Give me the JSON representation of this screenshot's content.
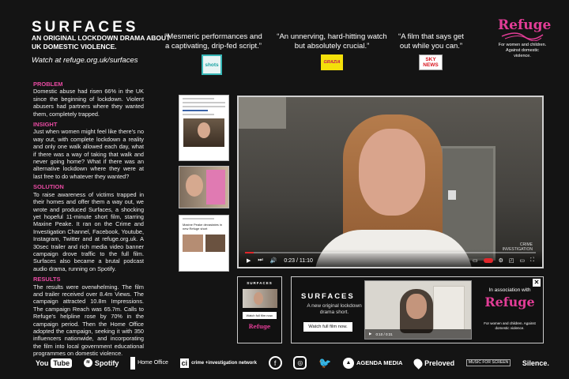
{
  "header": {
    "title": "SURFACES",
    "subtitle": "AN ORIGINAL LOCKDOWN DRAMA ABOUT UK DOMESTIC VIOLENCE.",
    "watch": "Watch at refuge.org.uk/surfaces"
  },
  "quotes": [
    {
      "text": "“Mesmeric performances and a captivating, drip-fed script.”",
      "source": "shots"
    },
    {
      "text": "“An unnerving, hard-hitting watch but absolutely crucial.”",
      "source": "GRAZIA"
    },
    {
      "text": "“A film that says get out while you can.”",
      "source_top": "SKY",
      "source_bottom": "NEWS"
    }
  ],
  "refuge": {
    "name": "Refuge",
    "tagline": "For women and children. Against domestic violence."
  },
  "sections": [
    {
      "heading": "PROBLEM",
      "body": "Domestic abuse had risen 66% in the UK since the beginning of lockdown. Violent abusers had partners where they wanted them, completely trapped."
    },
    {
      "heading": "INSIGHT",
      "body": "Just when women might feel like there's no way out, with complete lockdown a reality and only one walk allowed each day, what if there was a way of taking that walk and never going home? What if there was an alternative lockdown where they were at last free to do whatever they wanted?"
    },
    {
      "heading": "SOLUTION",
      "body": "To raise awareness of victims trapped in their homes and offer them a way out, we wrote and produced Surfaces, a shocking yet hopeful 11-minute short film, starring Maxine Peake. It ran on the Crime and Investigation Channel, Facebook, Youtube, Instagram, Twitter and at refuge.org.uk. A 30sec trailer and rich media video banner campaign drove traffic to the full film. Surfaces also became a brutal podcast audio drama, running on Spotify."
    },
    {
      "heading": "RESULTS",
      "body": "The results were overwhelming. The film and trailer received over 8.4m Views. The campaign attracted 10.8m Impressions. The campaign Reach was 65.7m. Calls to Refuge's helpline rose by 70% in the campaign period. Then the Home Office adopted the campaign, seeking it with 350 influencers nationwide, and incorporating the film into local government educational programmes on domestic violence."
    }
  ],
  "thumbs": {
    "news_title": "Maxine Peake devastates in new Refuge short"
  },
  "video": {
    "time": "0:23 / 11:10",
    "watermark_line1": "CRIME",
    "watermark_line2": "INVESTIGATION",
    "progress": 0.03
  },
  "mobile_ad": {
    "title": "SURFACES",
    "button": "Watch full film now.",
    "brand": "Refuge"
  },
  "banner_ad": {
    "title": "SURFACES",
    "description": "A new original lockdown drama short.",
    "button": "Watch full film now.",
    "video_time": "0:10 / 0:31",
    "association": "In association with",
    "brand": "Refuge",
    "brand_tagline": "For women and children. Against domestic violence.",
    "close": "✕"
  },
  "footer": {
    "youtube_a": "You",
    "youtube_b": "Tube",
    "spotify": "Spotify",
    "home_office": "Home Office",
    "crime_investigation": "crime +investigation network",
    "agenda": "AGENDA MEDIA",
    "preloved": "Preloved",
    "music_for_screen": "MUSIC FOR SCREEN",
    "silence": "Silence."
  },
  "colors": {
    "accent": "#e84aa2",
    "background": "#141414",
    "progress": "#e0262b"
  }
}
